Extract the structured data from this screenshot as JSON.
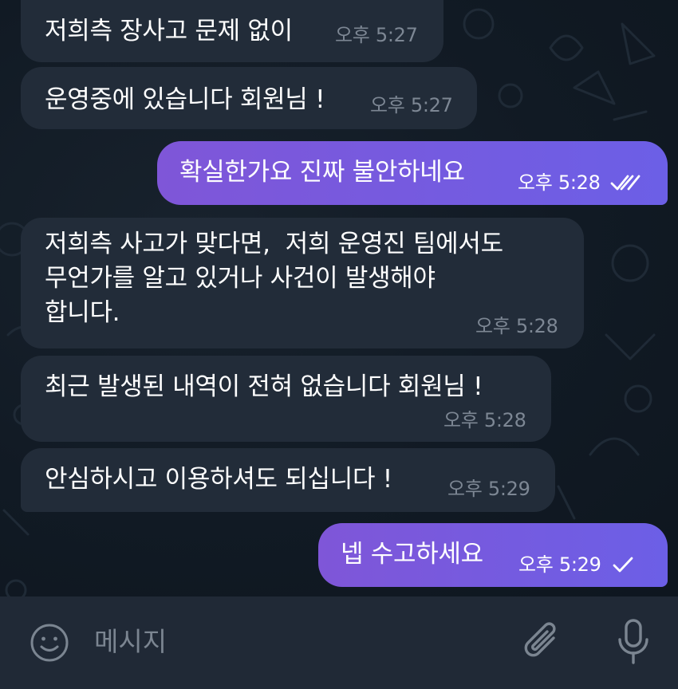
{
  "messages": [
    {
      "text": "저희측 장사고 문제 없이",
      "time": "오후 5:27"
    },
    {
      "text": "운영중에 있습니다 회원님 !",
      "time": "오후 5:27"
    },
    {
      "text": "확실한가요 진짜 불안하네요",
      "time": "오후 5:28"
    },
    {
      "text": "저희측 사고가 맞다면,  저희 운영진 팀에서도\n무언가를 알고 있거나 사건이 발생해야\n합니다.",
      "time": "오후 5:28"
    },
    {
      "text": "최근 발생된 내역이 전혀 없습니다 회원님 !",
      "time": "오후 5:28"
    },
    {
      "text": "안심하시고 이용하셔도 되십니다 !",
      "time": "오후 5:29"
    },
    {
      "text": "넵 수고하세요",
      "time": "오후 5:29"
    }
  ],
  "composer": {
    "placeholder": "메시지"
  },
  "colors": {
    "background": "#121b26",
    "incoming_bubble": "#222c39",
    "outgoing_bubble_start": "#7f56d8",
    "outgoing_bubble_end": "#6c5fe6",
    "composer_bar": "#202936",
    "muted_text": "#7d8794"
  },
  "icons": [
    "emoji-icon",
    "attach-icon",
    "microphone-icon",
    "double-check-icon",
    "single-check-icon"
  ]
}
